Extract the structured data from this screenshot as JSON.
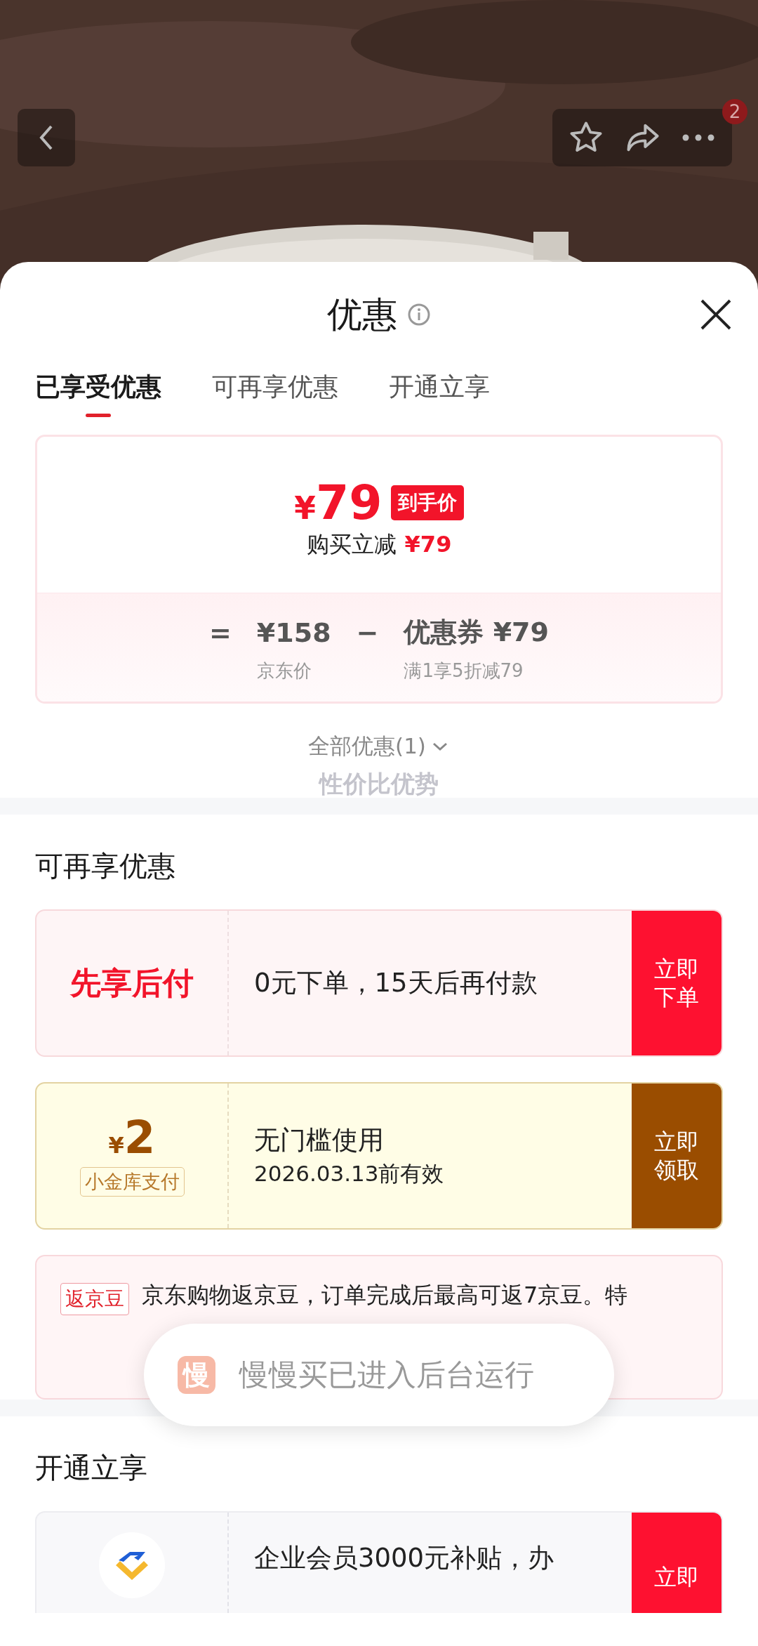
{
  "nav": {
    "badge": "2"
  },
  "sheet": {
    "title": "优惠"
  },
  "tabs": [
    {
      "label": "已享受优惠",
      "selected": true
    },
    {
      "label": "可再享优惠",
      "selected": false
    },
    {
      "label": "开通立享",
      "selected": false
    }
  ],
  "price_card": {
    "currency": "¥",
    "price": "79",
    "price_tag": "到手价",
    "reduction_label": "购买立减",
    "reduction_value": "¥79",
    "equals": "=",
    "jd_price": "¥158",
    "minus": "−",
    "coupon": "优惠券 ¥79",
    "jd_price_label": "京东价",
    "coupon_rule": "满1享5折减79"
  },
  "all_offers": "全部优惠(1)",
  "ghost_text": "性价比优势",
  "sections": [
    {
      "title": "可再享优惠",
      "offers": [
        {
          "kind": "pay_later",
          "left_title": "先享后付",
          "description": "0元下单，15天后再付款",
          "button": "立即下单"
        },
        {
          "kind": "coupon",
          "currency": "¥",
          "amount": "2",
          "source_tag": "小金库支付",
          "title": "无门槛使用",
          "validity": "2026.03.13前有效",
          "button": "立即领取"
        },
        {
          "kind": "rebate",
          "tag": "返京豆",
          "text": "京东购物返京豆，订单完成后最高可返7京豆。特"
        }
      ]
    },
    {
      "title": "开通立享",
      "offers": [
        {
          "kind": "membership",
          "description": "企业会员3000元补贴，办",
          "button": "立即"
        }
      ]
    }
  ],
  "toast": {
    "icon_glyph": "慢",
    "text": "慢慢买已进入后台运行"
  }
}
